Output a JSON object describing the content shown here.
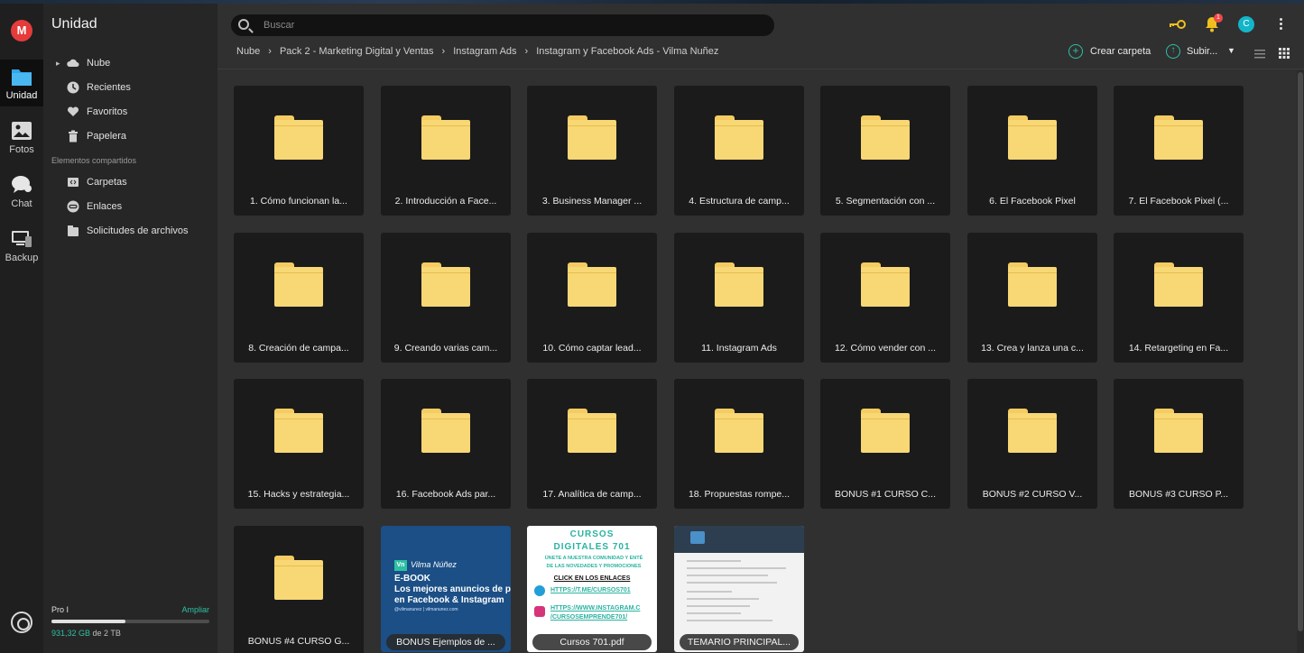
{
  "rail": {
    "logo": "M",
    "items": [
      {
        "label": "Unidad",
        "icon": "folder-icon"
      },
      {
        "label": "Fotos",
        "icon": "photos-icon"
      },
      {
        "label": "Chat",
        "icon": "chat-icon"
      },
      {
        "label": "Backup",
        "icon": "backup-icon"
      }
    ],
    "bottom_icon": "settings-icon"
  },
  "side": {
    "title": "Unidad",
    "nav": [
      {
        "label": "Nube",
        "icon": "cloud-icon"
      },
      {
        "label": "Recientes",
        "icon": "clock-icon"
      },
      {
        "label": "Favoritos",
        "icon": "heart-icon"
      },
      {
        "label": "Papelera",
        "icon": "trash-icon"
      }
    ],
    "shared_section": "Elementos compartidos",
    "shared": [
      {
        "label": "Carpetas",
        "icon": "shared-folder-icon"
      },
      {
        "label": "Enlaces",
        "icon": "link-icon"
      },
      {
        "label": "Solicitudes de archivos",
        "icon": "file-request-icon"
      }
    ],
    "quota": {
      "plan": "Pro I",
      "upgrade": "Ampliar",
      "used": "931,32 GB",
      "of_total": "de 2 TB",
      "fraction_used": 0.47
    }
  },
  "header": {
    "search_placeholder": "Buscar",
    "notification_count": "1",
    "avatar_initial": "C",
    "breadcrumb": [
      "Nube",
      "Pack 2 - Marketing Digital y Ventas",
      "Instagram Ads",
      "Instagram y Facebook Ads - Vilma Nuñez"
    ],
    "create_folder": "Crear carpeta",
    "upload": "Subir..."
  },
  "colors": {
    "accent": "#2ec0a3",
    "brand_red": "#e53b3b",
    "folder": "#f8d775",
    "avatar": "#13b6c9"
  },
  "items": [
    {
      "type": "folder",
      "name": "1. Cómo funcionan la..."
    },
    {
      "type": "folder",
      "name": "2. Introducción a Face..."
    },
    {
      "type": "folder",
      "name": "3. Business Manager ..."
    },
    {
      "type": "folder",
      "name": "4. Estructura de camp..."
    },
    {
      "type": "folder",
      "name": "5. Segmentación con ..."
    },
    {
      "type": "folder",
      "name": "6. El Facebook Pixel"
    },
    {
      "type": "folder",
      "name": "7. El Facebook Pixel (..."
    },
    {
      "type": "folder",
      "name": "8. Creación de campa..."
    },
    {
      "type": "folder",
      "name": "9. Creando varias cam..."
    },
    {
      "type": "folder",
      "name": "10. Cómo captar lead..."
    },
    {
      "type": "folder",
      "name": "11. Instagram Ads"
    },
    {
      "type": "folder",
      "name": "12. Cómo vender con ..."
    },
    {
      "type": "folder",
      "name": "13. Crea y lanza una c..."
    },
    {
      "type": "folder",
      "name": "14. Retargeting en Fa..."
    },
    {
      "type": "folder",
      "name": "15. Hacks y estrategia..."
    },
    {
      "type": "folder",
      "name": "16. Facebook Ads par..."
    },
    {
      "type": "folder",
      "name": "17. Analítica de camp..."
    },
    {
      "type": "folder",
      "name": "18. Propuestas rompe..."
    },
    {
      "type": "folder",
      "name": "BONUS #1 CURSO C..."
    },
    {
      "type": "folder",
      "name": "BONUS #2 CURSO V..."
    },
    {
      "type": "folder",
      "name": "BONUS #3 CURSO P..."
    },
    {
      "type": "folder",
      "name": "BONUS #4 CURSO G..."
    },
    {
      "type": "ebook",
      "name": "BONUS Ejemplos de ...",
      "thumb": {
        "badge": "Vn",
        "author": "Vilma Núñez",
        "kind": "E-BOOK",
        "line1": "Los mejores anuncios de p",
        "line2": "en Facebook & Instagram",
        "handle": "@vilmanunez | vilmanunez.com"
      }
    },
    {
      "type": "pdf",
      "name": "Cursos 701.pdf",
      "thumb": {
        "h1": "CURSOS",
        "h2": "DIGITALES 701",
        "sub1": "ÚNETE A NUESTRA COMUNIDAD Y ENTÉ",
        "sub2": "DE LAS NOVEDADES Y PROMOCIONES",
        "click": "CLICK EN LOS ENLACES",
        "link1": "HTTPS://T.ME/CURSOS701",
        "link2": "HTTPS://WWW.INSTAGRAM.C",
        "link3": "/CURSOSEMPRENDE701/"
      }
    },
    {
      "type": "doc",
      "name": "TEMARIO PRINCIPAL..."
    }
  ]
}
